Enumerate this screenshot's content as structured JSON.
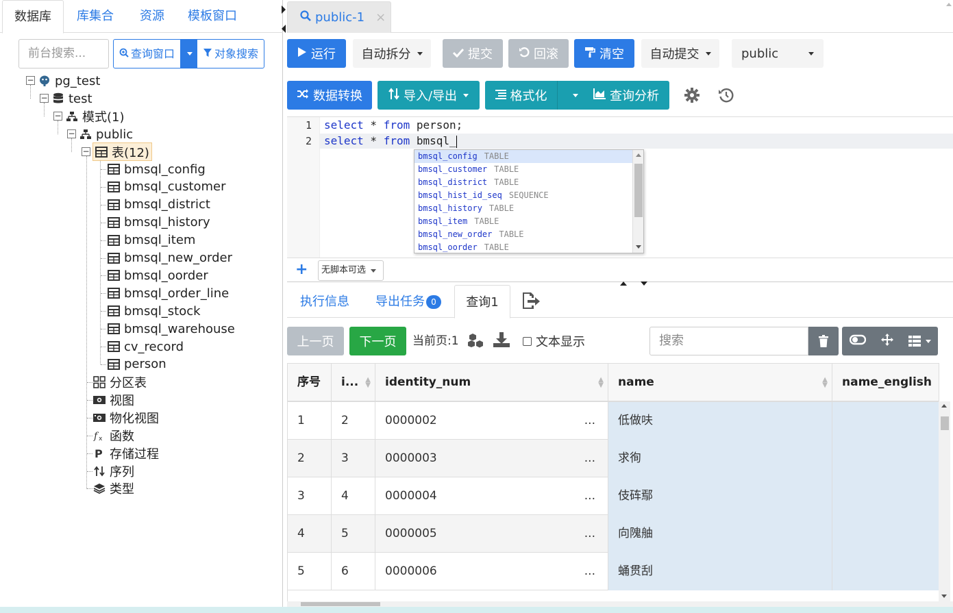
{
  "left_tabs": [
    "数据库",
    "库集合",
    "资源",
    "模板窗口"
  ],
  "left_search": {
    "placeholder": "前台搜索..."
  },
  "left_buttons": {
    "query_window": "查询窗口",
    "object_search": "对象搜索"
  },
  "tree": {
    "connection": "pg_test",
    "database": "test",
    "schemas_folder": "模式(1)",
    "schema": "public",
    "tables_folder": "表(12)",
    "tables": [
      "bmsql_config",
      "bmsql_customer",
      "bmsql_district",
      "bmsql_history",
      "bmsql_item",
      "bmsql_new_order",
      "bmsql_oorder",
      "bmsql_order_line",
      "bmsql_stock",
      "bmsql_warehouse",
      "cv_record",
      "person"
    ],
    "other_folders": [
      {
        "label": "分区表",
        "icon": "partition-table-icon"
      },
      {
        "label": "视图",
        "icon": "view-icon"
      },
      {
        "label": "物化视图",
        "icon": "materialized-view-icon"
      },
      {
        "label": "函数",
        "icon": "function-icon"
      },
      {
        "label": "存储过程",
        "icon": "procedure-icon"
      },
      {
        "label": "序列",
        "icon": "sequence-icon"
      },
      {
        "label": "类型",
        "icon": "type-icon"
      }
    ]
  },
  "query_tab": {
    "label": "public-1",
    "close": "×"
  },
  "toolbar": {
    "run": "运行",
    "auto_split": "自动拆分",
    "commit": "提交",
    "rollback": "回滚",
    "clear": "清空",
    "auto_commit": "自动提交",
    "schema": "public",
    "data_convert": "数据转换",
    "import_export": "导入/导出",
    "format": "格式化",
    "query_analyze": "查询分析"
  },
  "editor": {
    "lines": [
      {
        "num": "1",
        "kw1": "select",
        "mid": " * ",
        "kw2": "from",
        "rest": " person;"
      },
      {
        "num": "2",
        "kw1": "select",
        "mid": " * ",
        "kw2": "from",
        "rest": " bmsql_"
      }
    ],
    "autocomplete": [
      {
        "name": "bmsql_config",
        "type": "TABLE"
      },
      {
        "name": "bmsql_customer",
        "type": "TABLE"
      },
      {
        "name": "bmsql_district",
        "type": "TABLE"
      },
      {
        "name": "bmsql_hist_id_seq",
        "type": "SEQUENCE"
      },
      {
        "name": "bmsql_history",
        "type": "TABLE"
      },
      {
        "name": "bmsql_item",
        "type": "TABLE"
      },
      {
        "name": "bmsql_new_order",
        "type": "TABLE"
      },
      {
        "name": "bmsql_oorder",
        "type": "TABLE"
      }
    ],
    "script_select": "无脚本可选"
  },
  "result_tabs": {
    "exec_info": "执行信息",
    "export_task": "导出任务",
    "export_count": "0",
    "query": "查询1"
  },
  "result_toolbar": {
    "prev": "上一页",
    "next": "下一页",
    "current_page": "当前页:1",
    "text_display": "文本显示",
    "search_placeholder": "搜索"
  },
  "grid": {
    "headers": [
      "序号",
      "i...",
      "identity_num",
      "name",
      "name_english"
    ],
    "rows": [
      {
        "seq": "1",
        "i": "2",
        "identity_num": "0000002",
        "more": "...",
        "name": "低做呋",
        "name_english": ""
      },
      {
        "seq": "2",
        "i": "3",
        "identity_num": "0000003",
        "more": "...",
        "name": "求徇",
        "name_english": ""
      },
      {
        "seq": "3",
        "i": "4",
        "identity_num": "0000004",
        "more": "...",
        "name": "伎砗鄢",
        "name_english": ""
      },
      {
        "seq": "4",
        "i": "5",
        "identity_num": "0000005",
        "more": "...",
        "name": "向隗舳",
        "name_english": ""
      },
      {
        "seq": "5",
        "i": "6",
        "identity_num": "0000006",
        "more": "...",
        "name": "蛹贯刮",
        "name_english": ""
      }
    ]
  },
  "colors": {
    "primary": "#2c7be5",
    "teal": "#1a9fb0",
    "success": "#28a745",
    "disabled": "#b8bfc6",
    "dark": "#6c757d"
  }
}
